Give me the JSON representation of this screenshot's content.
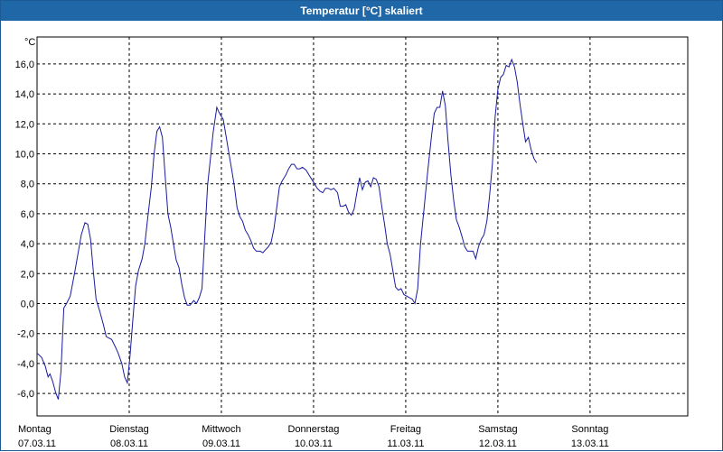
{
  "window": {
    "title": "Temperatur [°C] skaliert"
  },
  "colors": {
    "line": "#1a1aa0",
    "grid": "#000000",
    "titlebar": "#1f67a7"
  },
  "chart_data": {
    "type": "line",
    "title": "Temperatur [°C] skaliert",
    "ylabel": "°C",
    "xlabel": "",
    "ylim": [
      -7.5,
      17.8
    ],
    "xlim": [
      0,
      7.06
    ],
    "grid": true,
    "y_ticks": [
      "16,0",
      "14,0",
      "12,0",
      "10,0",
      "8,0",
      "6,0",
      "4,0",
      "2,0",
      "0,0",
      "-2,0",
      "-4,0",
      "-6,0"
    ],
    "y_tick_values": [
      16,
      14,
      12,
      10,
      8,
      6,
      4,
      2,
      0,
      -2,
      -4,
      -6
    ],
    "x_ticks": [
      {
        "day": "Montag",
        "date": "07.03.11"
      },
      {
        "day": "Dienstag",
        "date": "08.03.11"
      },
      {
        "day": "Mittwoch",
        "date": "09.03.11"
      },
      {
        "day": "Donnerstag",
        "date": "10.03.11"
      },
      {
        "day": "Freitag",
        "date": "11.03.11"
      },
      {
        "day": "Samstag",
        "date": "12.03.11"
      },
      {
        "day": "Sonntag",
        "date": "13.03.11"
      }
    ],
    "series": [
      {
        "values": [
          [
            0.0,
            -3.3
          ],
          [
            0.05,
            -3.6
          ],
          [
            0.09,
            -4.2
          ],
          [
            0.12,
            -4.9
          ],
          [
            0.14,
            -4.7
          ],
          [
            0.17,
            -5.2
          ],
          [
            0.2,
            -5.9
          ],
          [
            0.23,
            -6.4
          ],
          [
            0.26,
            -4.5
          ],
          [
            0.29,
            -0.3
          ],
          [
            0.32,
            0.0
          ],
          [
            0.36,
            0.5
          ],
          [
            0.4,
            1.8
          ],
          [
            0.44,
            3.2
          ],
          [
            0.48,
            4.6
          ],
          [
            0.52,
            5.4
          ],
          [
            0.55,
            5.3
          ],
          [
            0.58,
            4.3
          ],
          [
            0.61,
            2.2
          ],
          [
            0.64,
            0.3
          ],
          [
            0.68,
            -0.5
          ],
          [
            0.72,
            -1.4
          ],
          [
            0.75,
            -2.2
          ],
          [
            0.78,
            -2.3
          ],
          [
            0.81,
            -2.4
          ],
          [
            0.85,
            -2.9
          ],
          [
            0.88,
            -3.3
          ],
          [
            0.92,
            -4.0
          ],
          [
            0.95,
            -4.9
          ],
          [
            0.98,
            -5.3
          ],
          [
            1.01,
            -3.4
          ],
          [
            1.04,
            -1.0
          ],
          [
            1.07,
            1.2
          ],
          [
            1.1,
            2.2
          ],
          [
            1.14,
            3.0
          ],
          [
            1.17,
            4.0
          ],
          [
            1.2,
            5.7
          ],
          [
            1.24,
            7.8
          ],
          [
            1.27,
            10.0
          ],
          [
            1.3,
            11.5
          ],
          [
            1.33,
            11.8
          ],
          [
            1.36,
            11.1
          ],
          [
            1.39,
            8.5
          ],
          [
            1.42,
            6.0
          ],
          [
            1.45,
            5.1
          ],
          [
            1.48,
            4.0
          ],
          [
            1.51,
            2.9
          ],
          [
            1.54,
            2.4
          ],
          [
            1.57,
            1.3
          ],
          [
            1.6,
            0.4
          ],
          [
            1.63,
            -0.1
          ],
          [
            1.66,
            -0.1
          ],
          [
            1.7,
            0.2
          ],
          [
            1.73,
            0.0
          ],
          [
            1.76,
            0.4
          ],
          [
            1.79,
            1.0
          ],
          [
            1.82,
            4.5
          ],
          [
            1.85,
            7.9
          ],
          [
            1.88,
            9.6
          ],
          [
            1.91,
            11.4
          ],
          [
            1.95,
            13.1
          ],
          [
            1.98,
            12.7
          ],
          [
            2.02,
            12.3
          ],
          [
            2.05,
            11.2
          ],
          [
            2.08,
            10.1
          ],
          [
            2.11,
            9.0
          ],
          [
            2.14,
            7.9
          ],
          [
            2.17,
            6.4
          ],
          [
            2.2,
            5.8
          ],
          [
            2.23,
            5.5
          ],
          [
            2.26,
            4.9
          ],
          [
            2.29,
            4.6
          ],
          [
            2.32,
            4.2
          ],
          [
            2.35,
            3.7
          ],
          [
            2.38,
            3.5
          ],
          [
            2.42,
            3.5
          ],
          [
            2.45,
            3.4
          ],
          [
            2.48,
            3.6
          ],
          [
            2.51,
            3.8
          ],
          [
            2.54,
            4.1
          ],
          [
            2.57,
            5.0
          ],
          [
            2.6,
            6.4
          ],
          [
            2.63,
            7.8
          ],
          [
            2.66,
            8.2
          ],
          [
            2.7,
            8.6
          ],
          [
            2.73,
            9.0
          ],
          [
            2.76,
            9.3
          ],
          [
            2.79,
            9.3
          ],
          [
            2.82,
            9.0
          ],
          [
            2.85,
            9.0
          ],
          [
            2.88,
            9.1
          ],
          [
            2.92,
            8.9
          ],
          [
            2.95,
            8.6
          ],
          [
            2.98,
            8.3
          ],
          [
            3.01,
            8.0
          ],
          [
            3.04,
            7.7
          ],
          [
            3.07,
            7.5
          ],
          [
            3.1,
            7.4
          ],
          [
            3.13,
            7.7
          ],
          [
            3.16,
            7.7
          ],
          [
            3.19,
            7.6
          ],
          [
            3.22,
            7.7
          ],
          [
            3.26,
            7.4
          ],
          [
            3.29,
            6.5
          ],
          [
            3.32,
            6.5
          ],
          [
            3.35,
            6.6
          ],
          [
            3.38,
            6.1
          ],
          [
            3.41,
            5.9
          ],
          [
            3.44,
            6.3
          ],
          [
            3.47,
            7.4
          ],
          [
            3.5,
            8.4
          ],
          [
            3.53,
            7.6
          ],
          [
            3.56,
            8.1
          ],
          [
            3.59,
            8.2
          ],
          [
            3.62,
            7.8
          ],
          [
            3.65,
            8.4
          ],
          [
            3.68,
            8.3
          ],
          [
            3.71,
            7.8
          ],
          [
            3.74,
            6.5
          ],
          [
            3.77,
            5.3
          ],
          [
            3.8,
            4.0
          ],
          [
            3.83,
            3.3
          ],
          [
            3.86,
            2.2
          ],
          [
            3.89,
            1.1
          ],
          [
            3.92,
            0.9
          ],
          [
            3.95,
            1.0
          ],
          [
            3.98,
            0.6
          ],
          [
            4.01,
            0.5
          ],
          [
            4.04,
            0.4
          ],
          [
            4.07,
            0.3
          ],
          [
            4.1,
            0.0
          ],
          [
            4.13,
            1.0
          ],
          [
            4.16,
            3.9
          ],
          [
            4.2,
            6.4
          ],
          [
            4.24,
            8.9
          ],
          [
            4.28,
            11.2
          ],
          [
            4.31,
            12.7
          ],
          [
            4.34,
            13.1
          ],
          [
            4.37,
            13.1
          ],
          [
            4.4,
            14.2
          ],
          [
            4.43,
            13.2
          ],
          [
            4.46,
            10.8
          ],
          [
            4.49,
            8.6
          ],
          [
            4.52,
            6.9
          ],
          [
            4.55,
            5.6
          ],
          [
            4.58,
            5.1
          ],
          [
            4.61,
            4.5
          ],
          [
            4.64,
            3.8
          ],
          [
            4.67,
            3.5
          ],
          [
            4.7,
            3.5
          ],
          [
            4.73,
            3.5
          ],
          [
            4.76,
            3.0
          ],
          [
            4.79,
            3.8
          ],
          [
            4.82,
            4.3
          ],
          [
            4.85,
            4.6
          ],
          [
            4.88,
            5.5
          ],
          [
            4.91,
            7.2
          ],
          [
            4.94,
            9.3
          ],
          [
            4.97,
            12.5
          ],
          [
            5.0,
            14.3
          ],
          [
            5.03,
            15.1
          ],
          [
            5.06,
            15.3
          ],
          [
            5.09,
            15.9
          ],
          [
            5.12,
            15.8
          ],
          [
            5.15,
            16.3
          ],
          [
            5.18,
            15.8
          ],
          [
            5.21,
            14.8
          ],
          [
            5.24,
            13.3
          ],
          [
            5.27,
            12.0
          ],
          [
            5.3,
            10.8
          ],
          [
            5.33,
            11.1
          ],
          [
            5.36,
            10.3
          ],
          [
            5.39,
            9.7
          ],
          [
            5.42,
            9.4
          ]
        ]
      }
    ]
  }
}
